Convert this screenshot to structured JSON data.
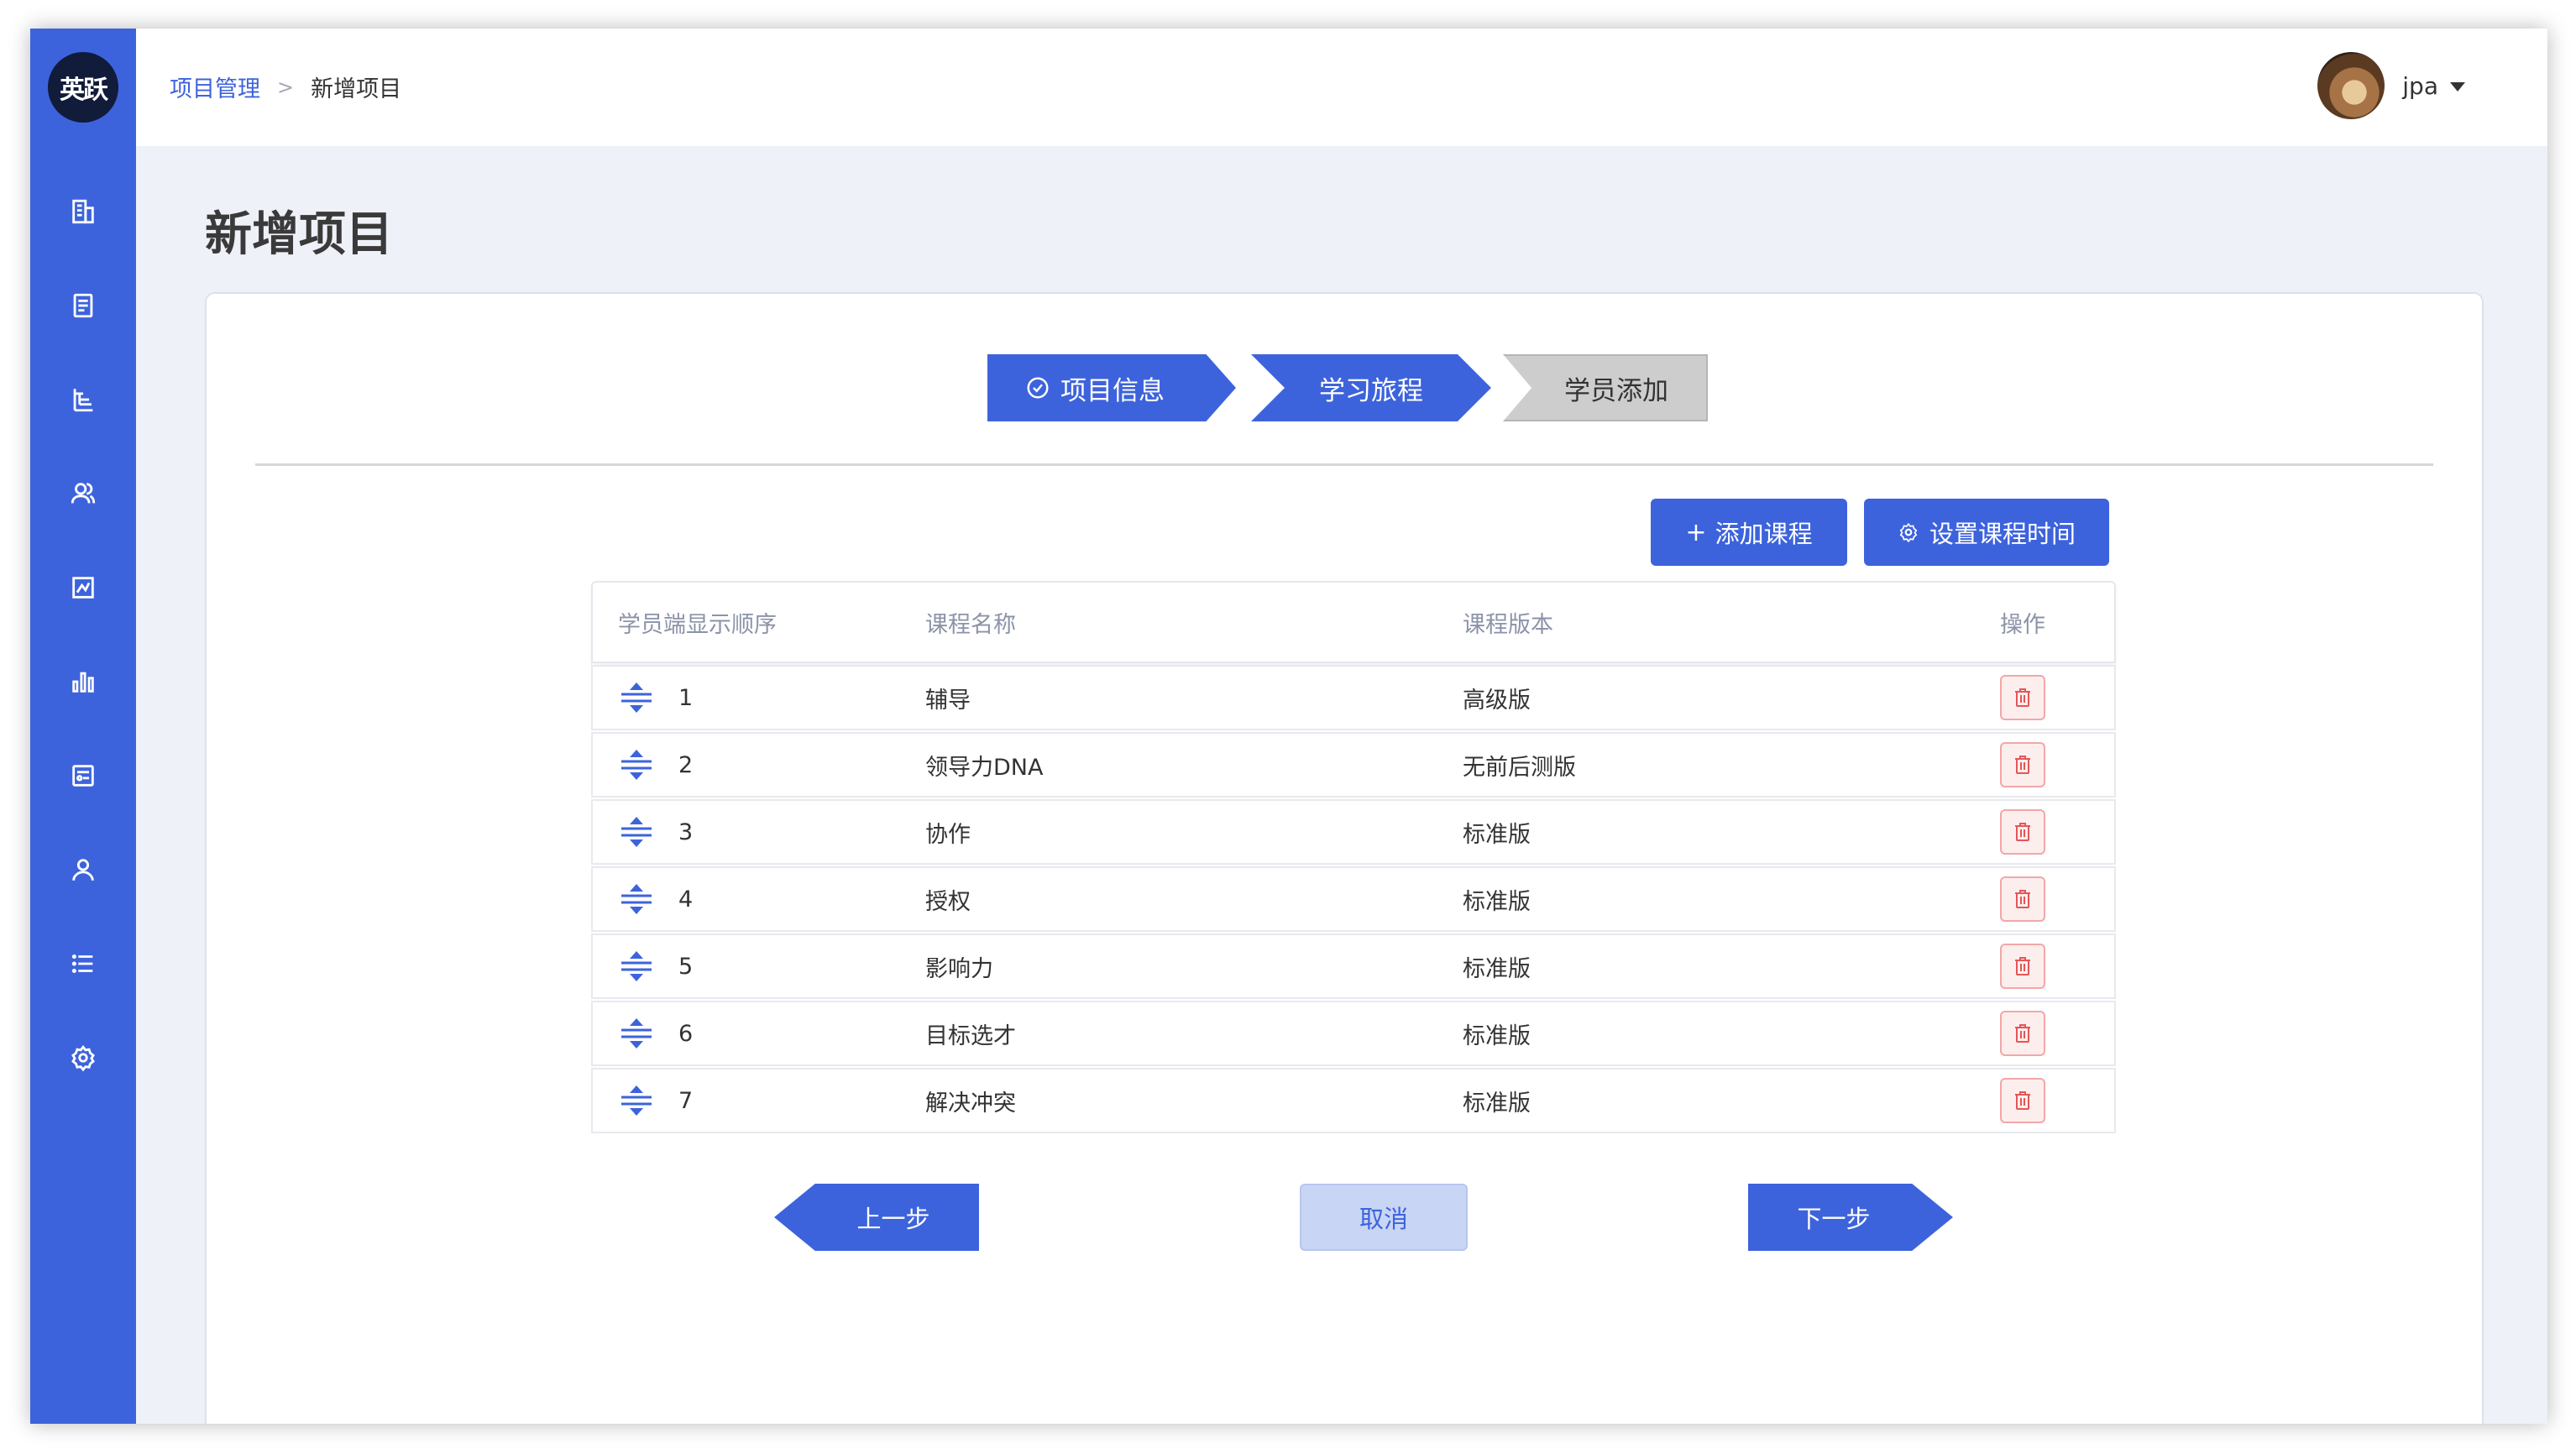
{
  "app": {
    "logo_text": "英跃",
    "user_name": "jpa"
  },
  "breadcrumb": {
    "parent": "项目管理",
    "current": "新增项目"
  },
  "page_title": "新增项目",
  "steps": [
    {
      "label": "项目信息",
      "state": "done"
    },
    {
      "label": "学习旅程",
      "state": "active"
    },
    {
      "label": "学员添加",
      "state": "pending"
    }
  ],
  "actions": {
    "add_course": "添加课程",
    "set_time": "设置课程时间"
  },
  "table": {
    "headers": [
      "学员端显示顺序",
      "课程名称",
      "课程版本",
      "操作"
    ],
    "rows": [
      {
        "order": "1",
        "name": "辅导",
        "version": "高级版"
      },
      {
        "order": "2",
        "name": "领导力DNA",
        "version": "无前后测版"
      },
      {
        "order": "3",
        "name": "协作",
        "version": "标准版"
      },
      {
        "order": "4",
        "name": "授权",
        "version": "标准版"
      },
      {
        "order": "5",
        "name": "影响力",
        "version": "标准版"
      },
      {
        "order": "6",
        "name": "目标选才",
        "version": "标准版"
      },
      {
        "order": "7",
        "name": "解决冲突",
        "version": "标准版"
      }
    ]
  },
  "footer": {
    "prev": "上一步",
    "cancel": "取消",
    "next": "下一步"
  },
  "colors": {
    "primary": "#3d63dc",
    "danger": "#e45656",
    "background": "#eef1f8"
  },
  "sidebar_icons": [
    "building-icon",
    "document-icon",
    "org-chart-icon",
    "users-icon",
    "analytics-icon",
    "bar-chart-icon",
    "report-icon",
    "user-icon",
    "list-icon",
    "settings-icon"
  ]
}
